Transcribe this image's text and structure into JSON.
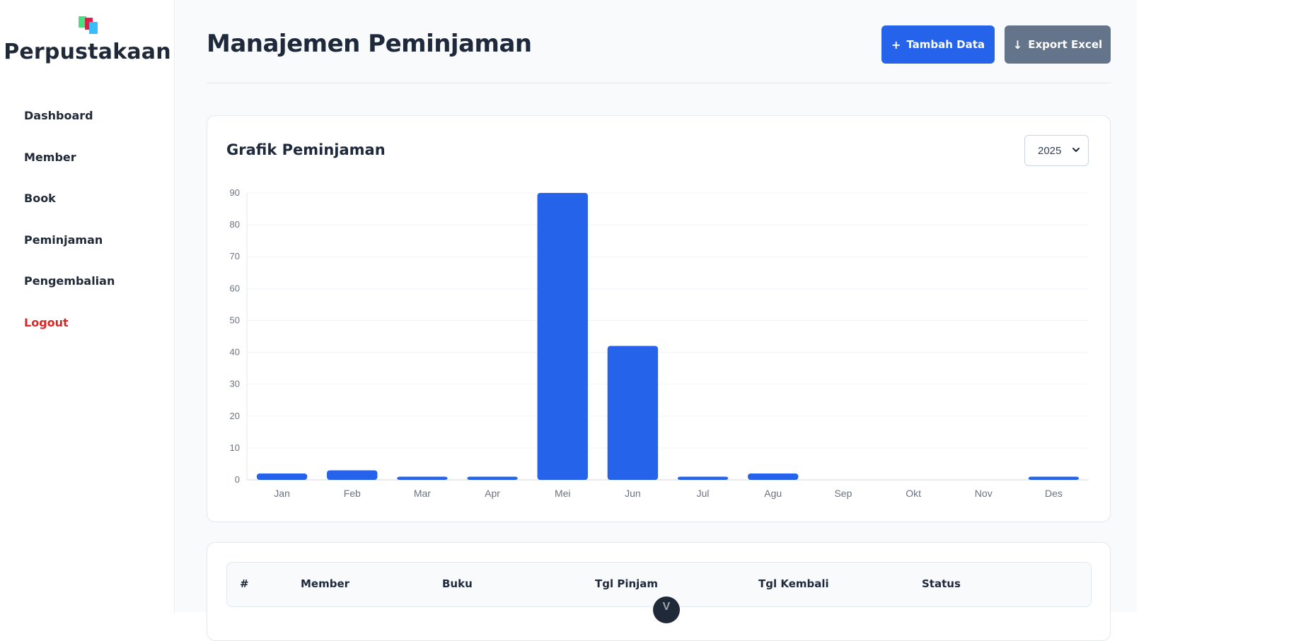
{
  "sidebar": {
    "brand_title": "Perpustakaan",
    "items": [
      {
        "label": "Dashboard"
      },
      {
        "label": "Member"
      },
      {
        "label": "Book"
      },
      {
        "label": "Peminjaman"
      },
      {
        "label": "Pengembalian"
      },
      {
        "label": "Logout"
      }
    ]
  },
  "header": {
    "title": "Manajemen Peminjaman",
    "add_button_icon": "+",
    "add_button_label": "Tambah Data",
    "export_button_icon": "↓",
    "export_button_label": "Export Excel"
  },
  "chart_card": {
    "title": "Grafik Peminjaman",
    "year_selected": "2025"
  },
  "colors": {
    "primary": "#2563eb",
    "secondary": "#64748b",
    "danger": "#dc2626"
  },
  "chart_data": {
    "type": "bar",
    "categories": [
      "Jan",
      "Feb",
      "Mar",
      "Apr",
      "Mei",
      "Jun",
      "Jul",
      "Agu",
      "Sep",
      "Okt",
      "Nov",
      "Des"
    ],
    "values": [
      2,
      3,
      1,
      1,
      90,
      42,
      1,
      2,
      0,
      0,
      0,
      1
    ],
    "ylim": [
      0,
      90
    ],
    "yticks": [
      0,
      10,
      20,
      30,
      40,
      50,
      60,
      70,
      80,
      90
    ],
    "grid": true,
    "bar_color": "#2563eb"
  },
  "table": {
    "columns": [
      "#",
      "Member",
      "Buku",
      "Tgl Pinjam",
      "Tgl Kembali",
      "Status"
    ]
  },
  "floating_button": {
    "glyph": "V"
  }
}
